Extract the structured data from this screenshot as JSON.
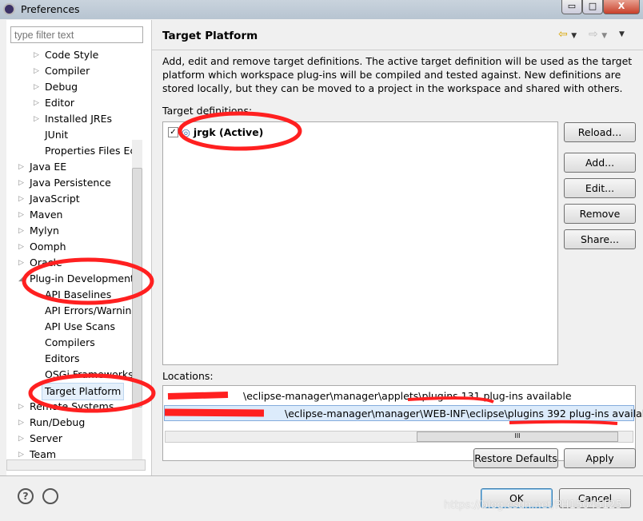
{
  "window": {
    "title": "Preferences",
    "minimize": "▭",
    "maximize": "□",
    "close": "X"
  },
  "filter": {
    "placeholder": "type filter text"
  },
  "tree": [
    {
      "label": "Code Style",
      "level": 1,
      "arrow": "▷"
    },
    {
      "label": "Compiler",
      "level": 1,
      "arrow": "▷"
    },
    {
      "label": "Debug",
      "level": 1,
      "arrow": "▷"
    },
    {
      "label": "Editor",
      "level": 1,
      "arrow": "▷"
    },
    {
      "label": "Installed JREs",
      "level": 1,
      "arrow": "▷"
    },
    {
      "label": "JUnit",
      "level": 1,
      "arrow": ""
    },
    {
      "label": "Properties Files Ec",
      "level": 1,
      "arrow": ""
    },
    {
      "label": "Java EE",
      "level": 0,
      "arrow": "▷"
    },
    {
      "label": "Java Persistence",
      "level": 0,
      "arrow": "▷"
    },
    {
      "label": "JavaScript",
      "level": 0,
      "arrow": "▷"
    },
    {
      "label": "Maven",
      "level": 0,
      "arrow": "▷"
    },
    {
      "label": "Mylyn",
      "level": 0,
      "arrow": "▷"
    },
    {
      "label": "Oomph",
      "level": 0,
      "arrow": "▷"
    },
    {
      "label": "Oracle",
      "level": 0,
      "arrow": "▷"
    },
    {
      "label": "Plug-in Development",
      "level": 0,
      "arrow": "◢"
    },
    {
      "label": "API Baselines",
      "level": 1,
      "arrow": ""
    },
    {
      "label": "API Errors/Warnin",
      "level": 1,
      "arrow": ""
    },
    {
      "label": "API Use Scans",
      "level": 1,
      "arrow": ""
    },
    {
      "label": "Compilers",
      "level": 1,
      "arrow": ""
    },
    {
      "label": "Editors",
      "level": 1,
      "arrow": ""
    },
    {
      "label": "OSGi Frameworks",
      "level": 1,
      "arrow": ""
    },
    {
      "label": "Target Platform",
      "level": 1,
      "arrow": "",
      "selected": true
    },
    {
      "label": "Remote Systems",
      "level": 0,
      "arrow": "▷"
    },
    {
      "label": "Run/Debug",
      "level": 0,
      "arrow": "▷"
    },
    {
      "label": "Server",
      "level": 0,
      "arrow": "▷"
    },
    {
      "label": "Team",
      "level": 0,
      "arrow": "▷"
    }
  ],
  "page": {
    "title": "Target Platform",
    "description": "Add, edit and remove target definitions.  The active target definition will be used as the target platform which workspace plug-ins will be compiled and tested against.  New definitions are stored locally, but they can be moved to a project in the workspace and shared with others.",
    "definitions_label": "Target definitions:",
    "definitions": [
      {
        "label": "jrgk (Active)",
        "checked": true
      }
    ],
    "buttons": {
      "reload": "Reload...",
      "add": "Add...",
      "edit": "Edit...",
      "remove": "Remove",
      "share": "Share..."
    },
    "locations_label": "Locations:",
    "locations": [
      "\\eclipse-manager\\manager\\applets\\plugins 131 plug-ins available",
      "\\eclipse-manager\\manager\\WEB-INF\\eclipse\\plugins 392 plug-ins available"
    ],
    "restore_defaults": "Restore Defaults",
    "apply": "Apply"
  },
  "footer": {
    "ok": "OK",
    "cancel": "Cancel",
    "help": "?",
    "watermark": "https://blog.csdn.net/PH15045125"
  },
  "colors": {
    "annotation": "#ff2020",
    "selection": "#e5f0fb"
  }
}
